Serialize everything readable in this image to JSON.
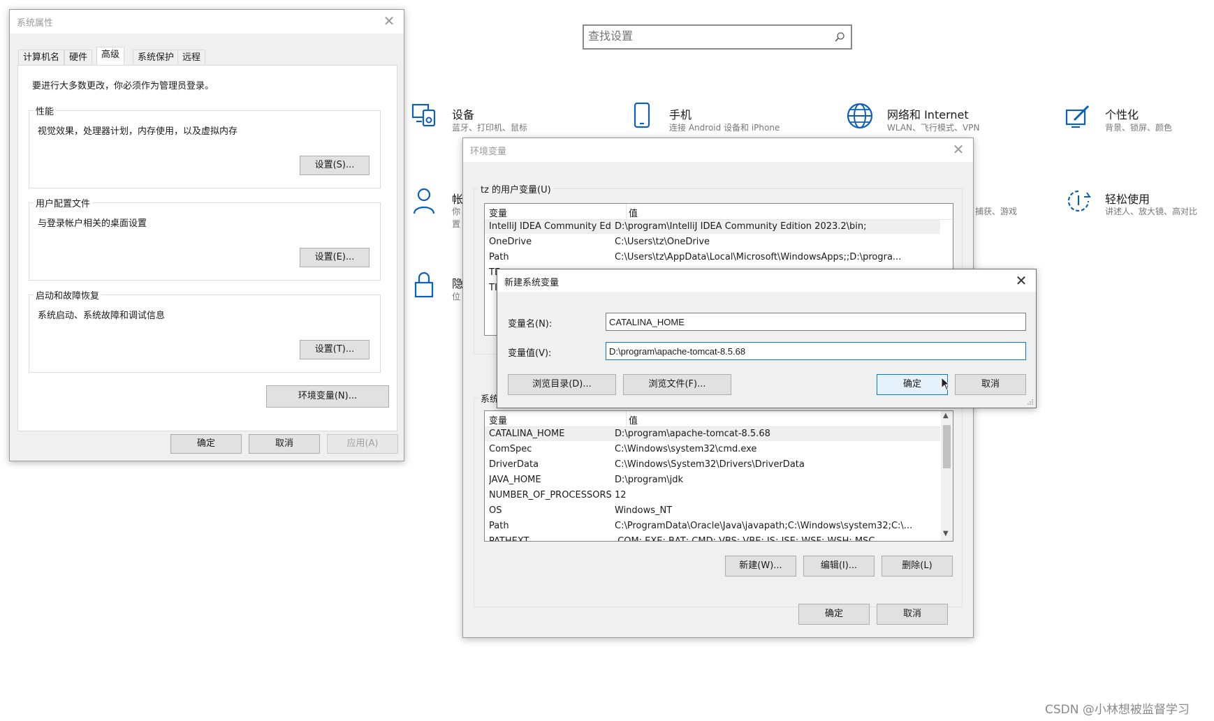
{
  "settings": {
    "search_placeholder": "查找设置",
    "tiles": [
      {
        "icon": "devices-icon",
        "title": "设备",
        "sub": "蓝牙、打印机、鼠标"
      },
      {
        "icon": "phone-icon",
        "title": "手机",
        "sub": "连接 Android 设备和 iPhone"
      },
      {
        "icon": "globe-icon",
        "title": "网络和 Internet",
        "sub": "WLAN、飞行模式、VPN"
      },
      {
        "icon": "personalization-icon",
        "title": "个性化",
        "sub": "背景、锁屏、颜色"
      },
      {
        "icon": "person-icon",
        "title": "帐",
        "sub": "你"
      },
      {
        "icon": "person-icon",
        "title": "",
        "sub": "置"
      },
      {
        "icon": "lock-icon",
        "title": "隐",
        "sub": "位"
      },
      {
        "icon": "ease-icon",
        "title": "轻松使用",
        "sub": "讲述人、放大镜、高对比"
      },
      {
        "icon": "gaming-icon",
        "title": "",
        "sub": "捕获、游戏"
      }
    ]
  },
  "sysprops": {
    "title": "系统属性",
    "tabs": [
      "计算机名",
      "硬件",
      "高级",
      "系统保护",
      "远程"
    ],
    "selected_tab": "高级",
    "admin_note": "要进行大多数更改，你必须作为管理员登录。",
    "perf": {
      "legend": "性能",
      "desc": "视觉效果，处理器计划，内存使用，以及虚拟内存",
      "button": "设置(S)..."
    },
    "profile": {
      "legend": "用户配置文件",
      "desc": "与登录帐户相关的桌面设置",
      "button": "设置(E)..."
    },
    "startup": {
      "legend": "启动和故障恢复",
      "desc": "系统启动、系统故障和调试信息",
      "button": "设置(T)..."
    },
    "env_button": "环境变量(N)...",
    "ok": "确定",
    "cancel": "取消",
    "apply": "应用(A)"
  },
  "envvars": {
    "title": "环境变量",
    "user_section": "tz 的用户变量(U)",
    "col_var": "变量",
    "col_val": "值",
    "user_rows": [
      {
        "name": "IntelliJ IDEA Community Ed...",
        "value": "D:\\program\\IntelliJ IDEA Community Edition 2023.2\\bin;"
      },
      {
        "name": "OneDrive",
        "value": "C:\\Users\\tz\\OneDrive"
      },
      {
        "name": "Path",
        "value": "C:\\Users\\tz\\AppData\\Local\\Microsoft\\WindowsApps;;D:\\progra..."
      },
      {
        "name": "TE",
        "value": ""
      },
      {
        "name": "TI",
        "value": ""
      }
    ],
    "sys_section": "系统",
    "sys_rows": [
      {
        "name": "CATALINA_HOME",
        "value": "D:\\program\\apache-tomcat-8.5.68"
      },
      {
        "name": "ComSpec",
        "value": "C:\\Windows\\system32\\cmd.exe"
      },
      {
        "name": "DriverData",
        "value": "C:\\Windows\\System32\\Drivers\\DriverData"
      },
      {
        "name": "JAVA_HOME",
        "value": "D:\\program\\jdk"
      },
      {
        "name": "NUMBER_OF_PROCESSORS",
        "value": "12"
      },
      {
        "name": "OS",
        "value": "Windows_NT"
      },
      {
        "name": "Path",
        "value": "C:\\ProgramData\\Oracle\\Java\\javapath;C:\\Windows\\system32;C:\\..."
      },
      {
        "name": "PATHEXT",
        "value": ".COM;.EXE;.BAT;.CMD;.VBS;.VBE;.JS;.JSE;.WSF;.WSH;.MSC"
      }
    ],
    "new": "新建(W)...",
    "edit": "编辑(I)...",
    "delete": "删除(L)",
    "ok": "确定",
    "cancel": "取消"
  },
  "newvar": {
    "title": "新建系统变量",
    "name_label": "变量名(N):",
    "name_value": "CATALINA_HOME",
    "value_label": "变量值(V):",
    "value_value": "D:\\program\\apache-tomcat-8.5.68",
    "browse_dir": "浏览目录(D)...",
    "browse_file": "浏览文件(F)...",
    "ok": "确定",
    "cancel": "取消"
  },
  "watermark": "CSDN @小林想被监督学习"
}
